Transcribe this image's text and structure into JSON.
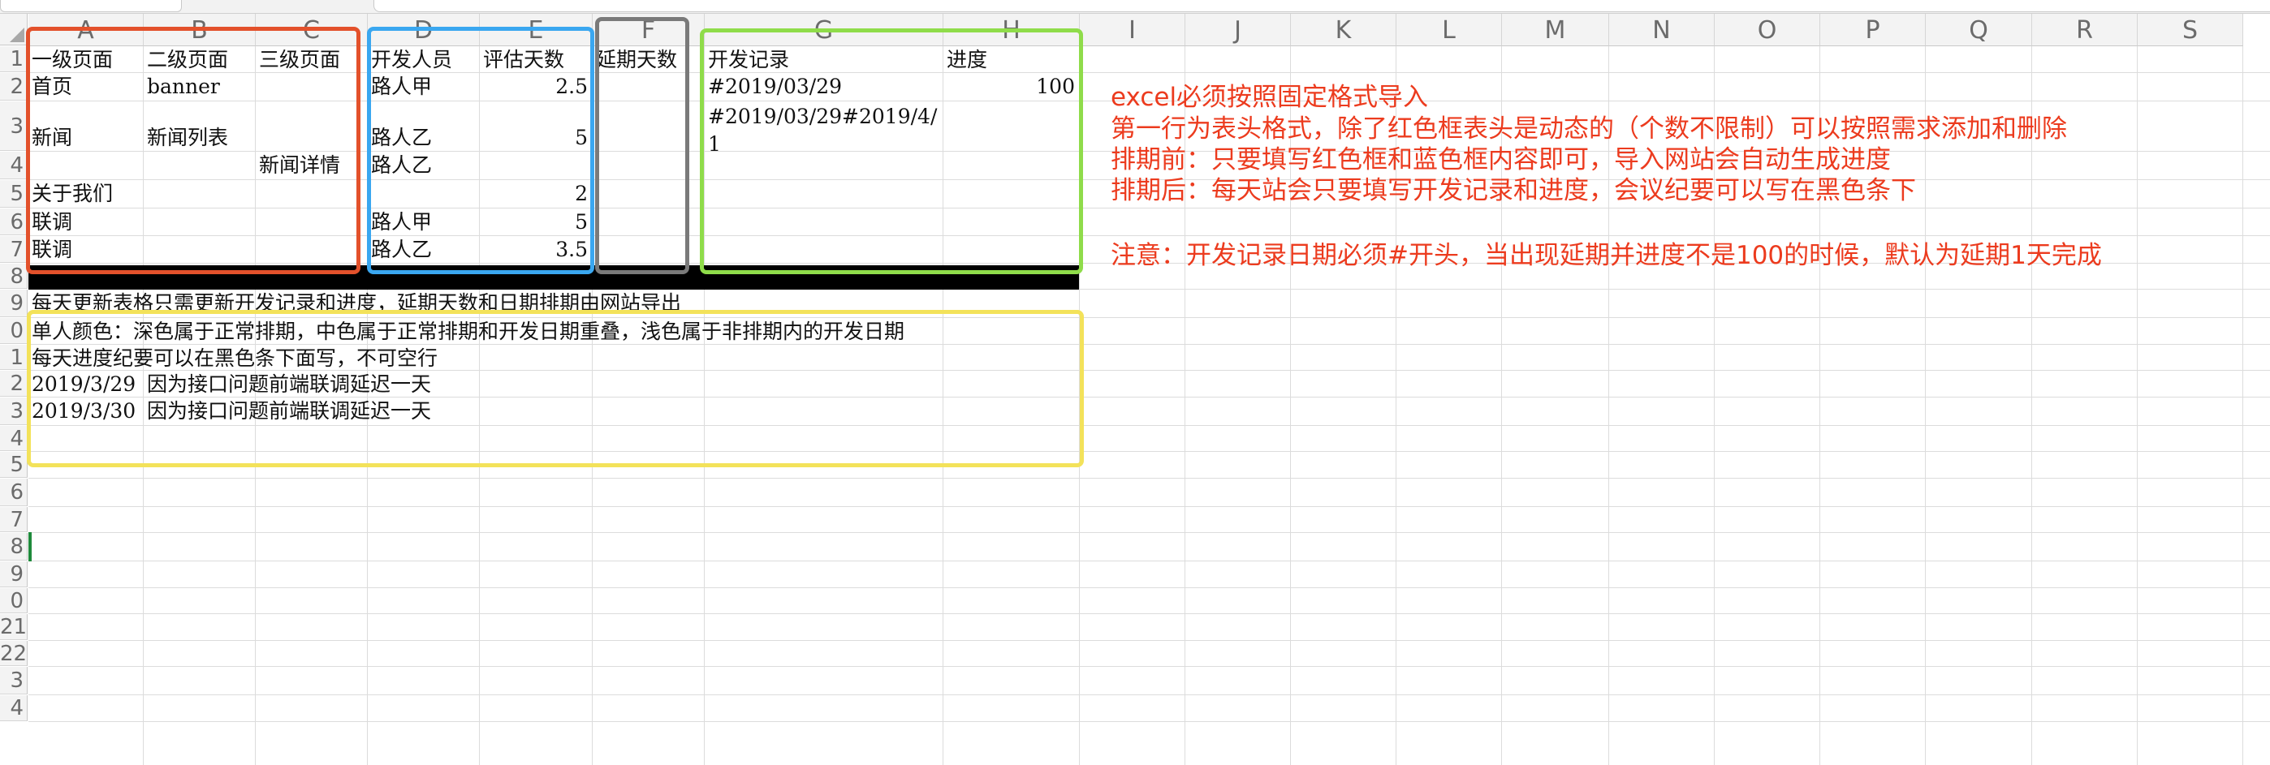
{
  "spreadsheet": {
    "columns": [
      "A",
      "B",
      "C",
      "D",
      "E",
      "F",
      "G",
      "H",
      "I",
      "J",
      "K",
      "L",
      "M",
      "N",
      "O",
      "P",
      "Q",
      "R",
      "S"
    ],
    "rows": [
      "1",
      "2",
      "3",
      "4",
      "5",
      "6",
      "7",
      "8",
      "9",
      "0",
      "1",
      "2",
      "3",
      "4",
      "5",
      "6",
      "7",
      "8",
      "9",
      "0",
      "21",
      "22",
      "3",
      "4"
    ],
    "cells": {
      "A1": "一级页面",
      "B1": "二级页面",
      "C1": "三级页面",
      "D1": "开发人员",
      "E1": "评估天数",
      "F1": "延期天数",
      "G1": "开发记录",
      "H1": "进度",
      "A2": "首页",
      "B2": "banner",
      "D2": "路人甲",
      "E2": "2.5",
      "G2": "#2019/03/29",
      "H2": "100",
      "A3": "新闻",
      "B3": "新闻列表",
      "D3": "路人乙",
      "E3": "5",
      "G3": "#2019/03/29#2019/4/1",
      "C4": "新闻详情",
      "D4": "路人乙",
      "A5": "关于我们",
      "E5": "2",
      "A6": "联调",
      "D6": "路人甲",
      "E6": "5",
      "A7": "联调",
      "D7": "路人乙",
      "E7": "3.5",
      "A9": "每天更新表格只需更新开发记录和进度，延期天数和日期排期由网站导出",
      "A10": "单人颜色：深色属于正常排期，中色属于正常排期和开发日期重叠，浅色属于非排期内的开发日期",
      "A11": "每天进度纪要可以在黑色条下面写，不可空行",
      "A12": "2019/3/29",
      "B12": "因为接口问题前端联调延迟一天",
      "A13": "2019/3/30",
      "B13": "因为接口问题前端联调延迟一天"
    },
    "notes": [
      "excel必须按照固定格式导入",
      "第一行为表头格式，除了红色框表头是动态的（个数不限制）可以按照需求添加和删除",
      "排期前：只要填写红色框和蓝色框内容即可，导入网站会自动生成进度",
      "排期后：每天站会只要填写开发记录和进度，会议纪要可以写在黑色条下",
      "注意：开发记录日期必须#开头，当出现延期并进度不是100的时候，默认为延期1天完成"
    ]
  },
  "colors": {
    "red_box": "#e3512b",
    "blue_box": "#3aa7f0",
    "gray_box": "#7a7a7a",
    "green_box": "#8fdc4a",
    "yellow_box": "#f3e25a",
    "note_text": "#ec3b1e",
    "black_bar": "#000000"
  }
}
